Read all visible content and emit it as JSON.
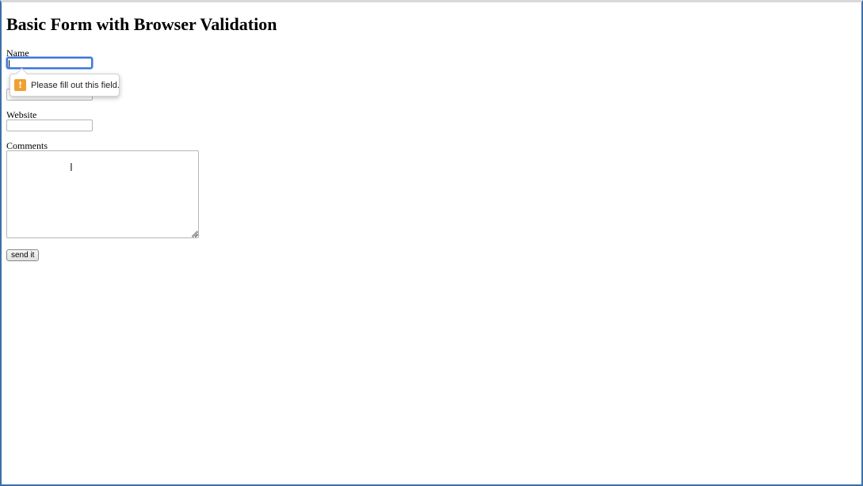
{
  "page": {
    "title": "Basic Form with Browser Validation"
  },
  "form": {
    "name_label": "Name",
    "email_label": "",
    "website_label": "Website",
    "comments_label": "Comments",
    "name_value": "",
    "email_value": "",
    "website_value": "",
    "comments_value": "",
    "submit_label": "send it"
  },
  "validation": {
    "message": "Please fill out this field.",
    "icon": "warning-icon",
    "icon_color": "#f0a030"
  },
  "colors": {
    "focus_ring": "#3b78d8",
    "window_border": "#3b6fa8"
  }
}
